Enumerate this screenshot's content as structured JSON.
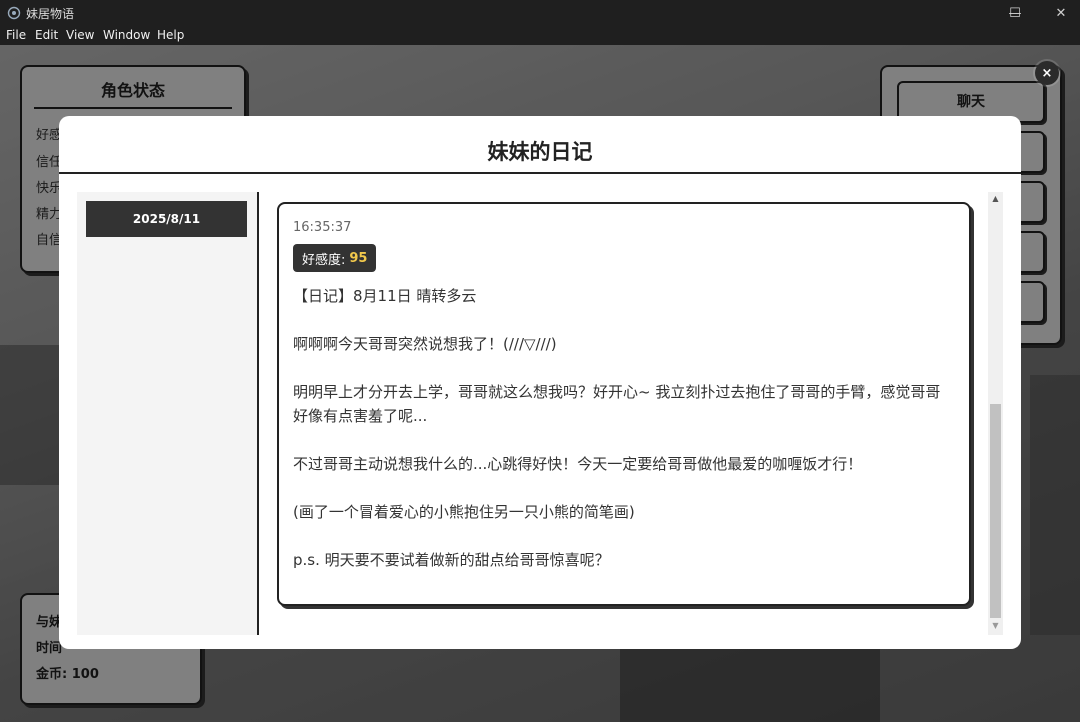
{
  "window": {
    "title": "妹居物语",
    "minimize": "—",
    "maximize": "☐",
    "close": "✕"
  },
  "menu": [
    "File",
    "Edit",
    "View",
    "Window",
    "Help"
  ],
  "background": {
    "status_panel": {
      "title": "角色状态",
      "rows": [
        "好感",
        "信任",
        "快乐",
        "精力",
        "自信"
      ]
    },
    "side_panel": {
      "chat_label": "聊天"
    },
    "bottom_panel": {
      "rows": [
        "与妹",
        "时间",
        "金币: 100"
      ]
    }
  },
  "overlay_close": "×",
  "diary": {
    "title": "妹妹的日记",
    "dates": [
      "2025/8/11"
    ],
    "entry": {
      "time": "16:35:37",
      "favor_label": "好感度:",
      "favor_value": "95",
      "text": "【日记】8月11日 晴转多云\n\n啊啊啊今天哥哥突然说想我了！(///▽///)\n\n明明早上才分开去上学，哥哥就这么想我吗？好开心~ 我立刻扑过去抱住了哥哥的手臂，感觉哥哥好像有点害羞了呢...\n\n不过哥哥主动说想我什么的...心跳得好快！今天一定要给哥哥做他最爱的咖喱饭才行！\n\n(画了一个冒着爱心的小熊抱住另一只小熊的简笔画)\n\np.s. 明天要不要试着做新的甜点给哥哥惊喜呢？"
    },
    "scroll_up": "▲",
    "scroll_down": "▼"
  }
}
